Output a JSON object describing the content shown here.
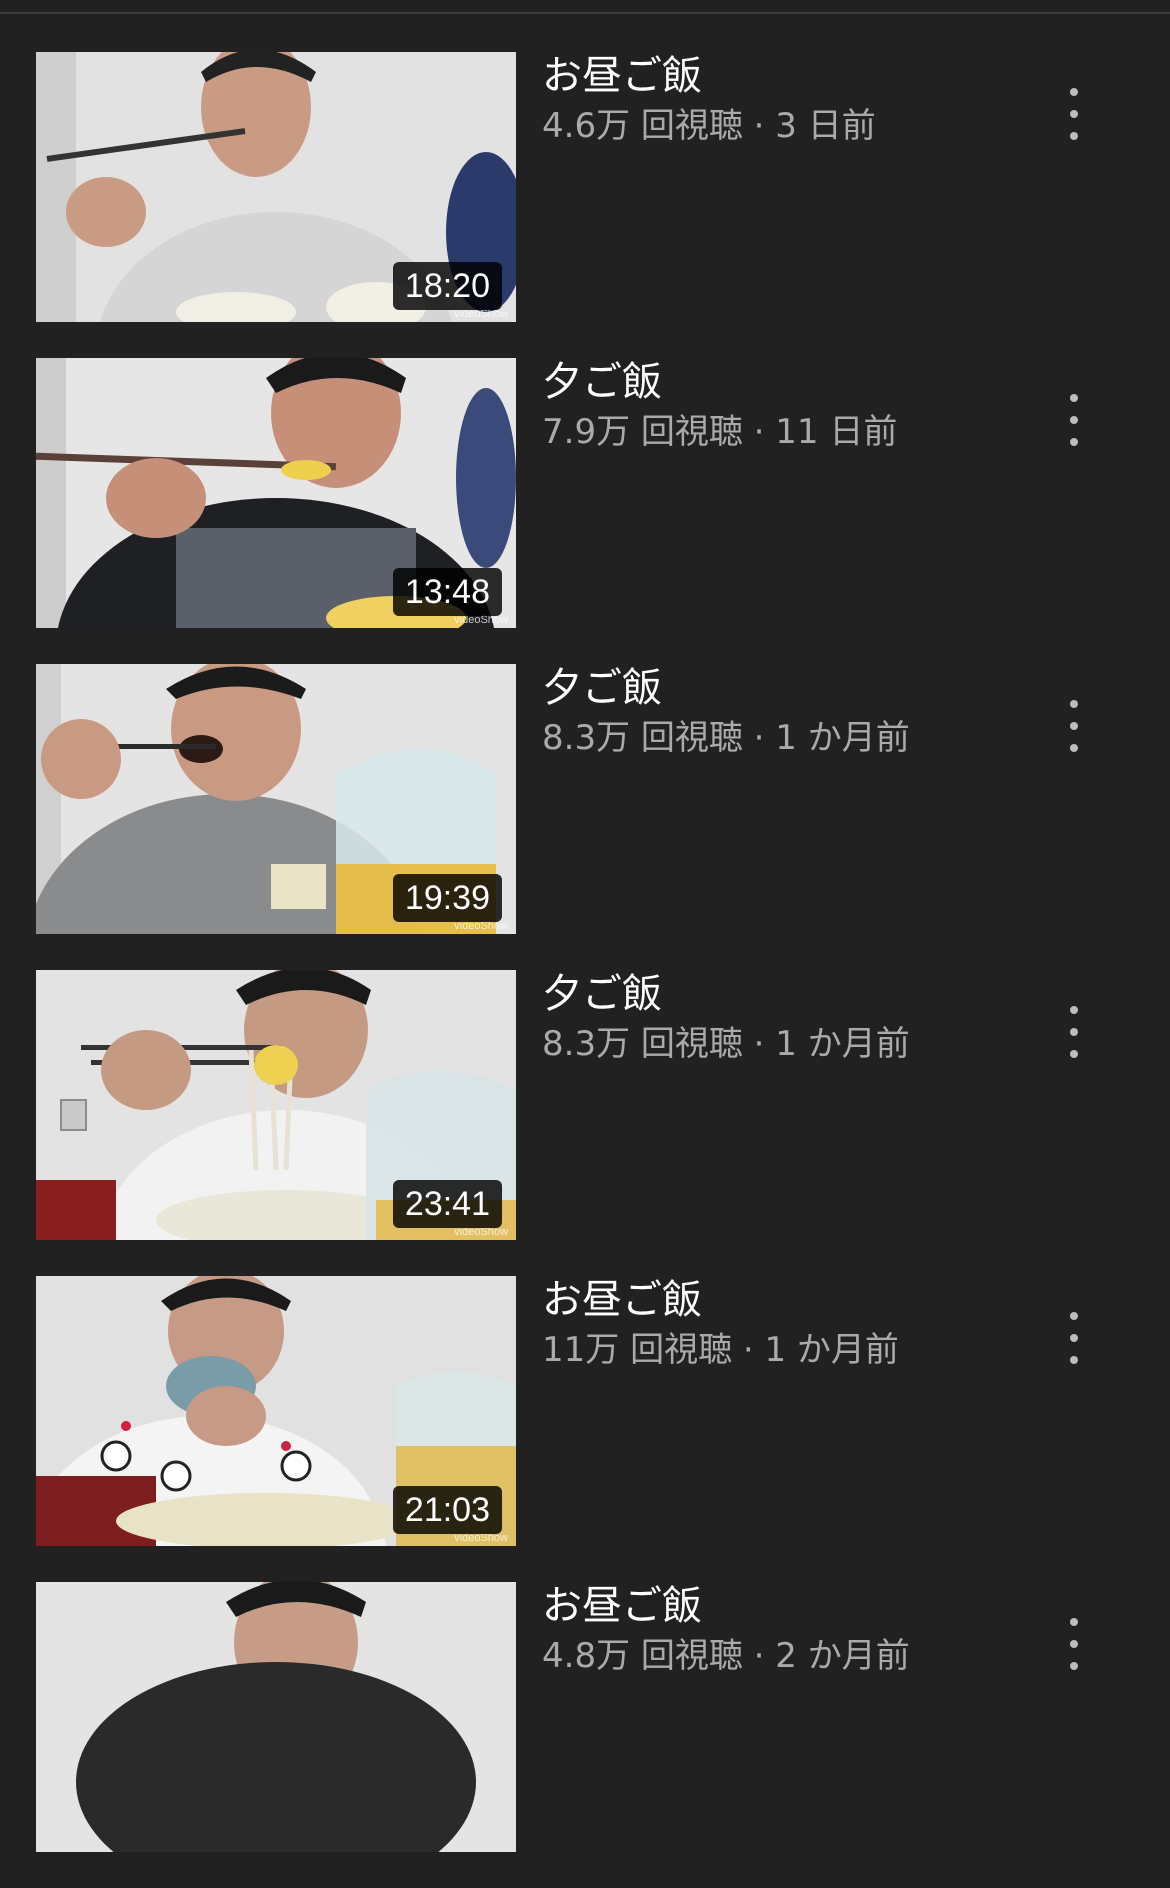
{
  "videos": [
    {
      "title": "お昼ご飯",
      "stats": "4.6万 回視聴 · 3 日前",
      "duration": "18:20",
      "watermark": "videoShow",
      "shirt_color": "#d9d9d9"
    },
    {
      "title": "夕ご飯",
      "stats": "7.9万 回視聴 · 11 日前",
      "duration": "13:48",
      "watermark": "videoShow",
      "shirt_color": "#1f2023"
    },
    {
      "title": "夕ご飯",
      "stats": "8.3万 回視聴 · 1 か月前",
      "duration": "19:39",
      "watermark": "videoShow",
      "shirt_color": "#8a8b8d"
    },
    {
      "title": "夕ご飯",
      "stats": "8.3万 回視聴 · 1 か月前",
      "duration": "23:41",
      "watermark": "videoShow",
      "shirt_color": "#f2f2f2"
    },
    {
      "title": "お昼ご飯",
      "stats": "11万 回視聴 · 1 か月前",
      "duration": "21:03",
      "watermark": "videoShow",
      "shirt_color": "#f4f4f4"
    },
    {
      "title": "お昼ご飯",
      "stats": "4.8万 回視聴 · 2 か月前",
      "duration": "",
      "watermark": "",
      "shirt_color": "#d0d0d0"
    }
  ],
  "icons": {
    "more": "vertical-ellipsis-icon"
  },
  "colors": {
    "background": "#212121",
    "title_text": "#ffffff",
    "meta_text": "#aaaaaa"
  }
}
